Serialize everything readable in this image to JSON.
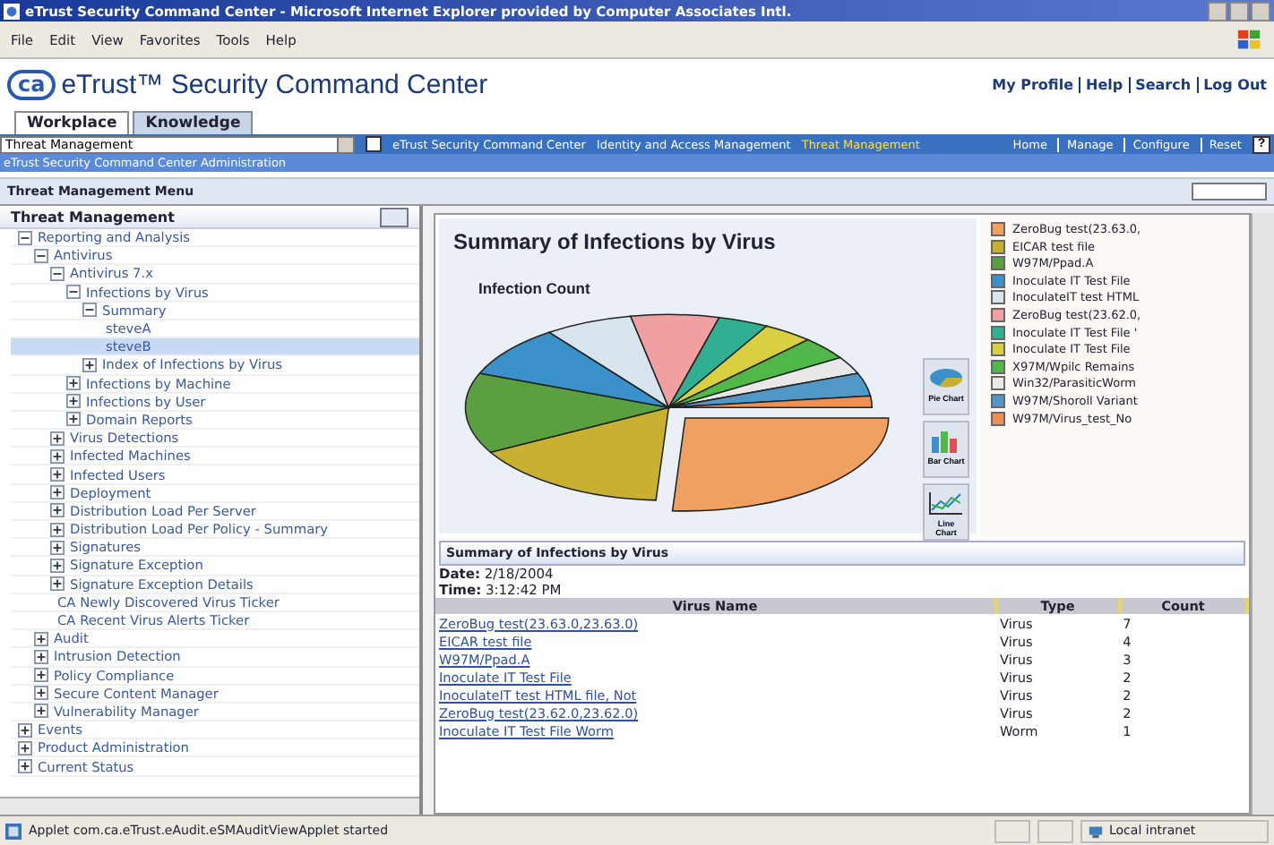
{
  "window": {
    "title": "eTrust Security Command Center - Microsoft Internet Explorer provided by Computer Associates Intl."
  },
  "menu_bar": [
    "File",
    "Edit",
    "View",
    "Favorites",
    "Tools",
    "Help"
  ],
  "header": {
    "logo": "ca",
    "title": "eTrust™ Security Command Center",
    "links": [
      "My Profile",
      "Help",
      "Search",
      "Log Out"
    ]
  },
  "tabs": [
    {
      "label": "Workplace",
      "selected": true
    },
    {
      "label": "Knowledge",
      "selected": false
    }
  ],
  "nav_bar": {
    "dropdown": "Threat Management",
    "links": [
      {
        "label": "eTrust Security Command Center",
        "selected": false
      },
      {
        "label": "Identity and Access Management",
        "selected": false
      },
      {
        "label": "Threat Management",
        "selected": true
      }
    ],
    "actions": [
      "Home",
      "Manage",
      "Configure",
      "Reset"
    ],
    "help": "?"
  },
  "admin_bar": "eTrust Security Command Center Administration",
  "menu_panel": {
    "title": "Threat Management Menu",
    "tree_title": "Threat Management",
    "tree": [
      {
        "label": "Reporting and Analysis",
        "expanded": true,
        "selected": false,
        "children": [
          {
            "label": "Antivirus",
            "expanded": true,
            "selected": false,
            "children": [
              {
                "label": "Antivirus 7.x",
                "expanded": true,
                "selected": false,
                "children": [
                  {
                    "label": "Infections by Virus",
                    "expanded": true,
                    "selected": false,
                    "children": [
                      {
                        "label": "Summary",
                        "expanded": true,
                        "selected": false,
                        "children": [
                          {
                            "label": "steveA",
                            "selected": false
                          },
                          {
                            "label": "steveB",
                            "selected": true
                          }
                        ]
                      },
                      {
                        "label": "Index of Infections by Virus",
                        "expanded": false,
                        "selected": false
                      }
                    ]
                  },
                  {
                    "label": "Infections by Machine",
                    "expanded": false,
                    "selected": false
                  },
                  {
                    "label": "Infections by User",
                    "expanded": false,
                    "selected": false
                  },
                  {
                    "label": "Domain Reports",
                    "expanded": false,
                    "selected": false
                  }
                ]
              },
              {
                "label": "Virus Detections",
                "expanded": false,
                "selected": false
              },
              {
                "label": "Infected Machines",
                "expanded": false,
                "selected": false
              },
              {
                "label": "Infected Users",
                "expanded": false,
                "selected": false
              },
              {
                "label": "Deployment",
                "expanded": false,
                "selected": false
              },
              {
                "label": "Distribution Load Per Server",
                "expanded": false,
                "selected": false
              },
              {
                "label": "Distribution Load Per Policy - Summary",
                "expanded": false,
                "selected": false
              },
              {
                "label": "Signatures",
                "expanded": false,
                "selected": false
              },
              {
                "label": "Signature Exception",
                "expanded": false,
                "selected": false
              },
              {
                "label": "Signature Exception Details",
                "expanded": false,
                "selected": false
              },
              {
                "label": "CA Newly Discovered Virus Ticker",
                "selected": false
              },
              {
                "label": "CA Recent Virus Alerts Ticker",
                "selected": false
              }
            ]
          },
          {
            "label": "Audit",
            "expanded": false,
            "selected": false
          },
          {
            "label": "Intrusion Detection",
            "expanded": false,
            "selected": false
          },
          {
            "label": "Policy Compliance",
            "expanded": false,
            "selected": false
          },
          {
            "label": "Secure Content Manager",
            "expanded": false,
            "selected": false
          },
          {
            "label": "Vulnerability Manager",
            "expanded": false,
            "selected": false
          }
        ]
      },
      {
        "label": "Events",
        "expanded": false,
        "selected": false
      },
      {
        "label": "Product Administration",
        "expanded": false,
        "selected": false
      },
      {
        "label": "Current Status",
        "expanded": false,
        "selected": false
      }
    ]
  },
  "report": {
    "chart_title": "Summary of Infections by Virus",
    "chart_subtitle": "Infection Count",
    "chart_buttons": [
      {
        "kind": "pie",
        "label": "Pie Chart"
      },
      {
        "kind": "bar",
        "label": "Bar Chart"
      },
      {
        "kind": "line",
        "label": "Line Chart"
      }
    ],
    "legend": [
      {
        "label": "ZeroBug test(23.63.0,",
        "color": "#f0a060"
      },
      {
        "label": "EICAR test file",
        "color": "#c8b030"
      },
      {
        "label": "W97M/Ppad.A",
        "color": "#5aa040"
      },
      {
        "label": "Inoculate IT Test File",
        "color": "#3a90c8"
      },
      {
        "label": "InoculateIT test HTML",
        "color": "#d8e4ee"
      },
      {
        "label": "ZeroBug test(23.62.0,",
        "color": "#f0a0a0"
      },
      {
        "label": "Inoculate IT Test File '",
        "color": "#30b090"
      },
      {
        "label": "Inoculate IT Test File",
        "color": "#d8d040"
      },
      {
        "label": "X97M/Wpilc Remains",
        "color": "#50b848"
      },
      {
        "label": "Win32/ParasiticWorm",
        "color": "#e8e8e8"
      },
      {
        "label": "W97M/Shoroll Variant",
        "color": "#5098c8"
      },
      {
        "label": "W97M/Virus_test_No",
        "color": "#f09050"
      }
    ],
    "table_title": "Summary of Infections by Virus",
    "date_label": "Date:",
    "date": "2/18/2004",
    "time_label": "Time:",
    "time": "3:12:42 PM",
    "columns": [
      "Virus Name",
      "Type",
      "Count"
    ],
    "rows": [
      [
        "ZeroBug test(23.63.0,23.63.0)",
        "Virus",
        "7"
      ],
      [
        "EICAR test file",
        "Virus",
        "4"
      ],
      [
        "W97M/Ppad.A",
        "Virus",
        "3"
      ],
      [
        "Inoculate IT Test File",
        "Virus",
        "2"
      ],
      [
        "InoculateIT test HTML file, Not",
        "Virus",
        "2"
      ],
      [
        "ZeroBug test(23.62.0,23.62.0)",
        "Virus",
        "2"
      ],
      [
        "Inoculate IT Test File Worm",
        "Worm",
        "1"
      ]
    ]
  },
  "status_bar": {
    "text": "Applet com.ca.eTrust.eAudit.eSMAuditViewApplet started",
    "zone": "Local intranet"
  }
}
